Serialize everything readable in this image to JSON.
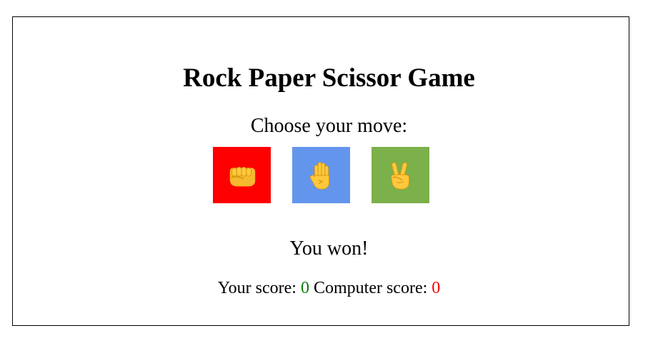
{
  "game": {
    "title": "Rock Paper Scissor Game",
    "prompt": "Choose your move:",
    "moves": [
      {
        "name": "rock",
        "icon": "fist-icon",
        "color": "#ff0000"
      },
      {
        "name": "paper",
        "icon": "raised-hand-icon",
        "color": "#6495ed"
      },
      {
        "name": "scissor",
        "icon": "victory-hand-icon",
        "color": "#7cb04a"
      }
    ],
    "result": "You won!",
    "score": {
      "player_label": "Your score: ",
      "player_value": "0",
      "player_color": "#0a7d0a",
      "computer_label": " Computer score: ",
      "computer_value": "0",
      "computer_color": "#ff0000"
    }
  }
}
